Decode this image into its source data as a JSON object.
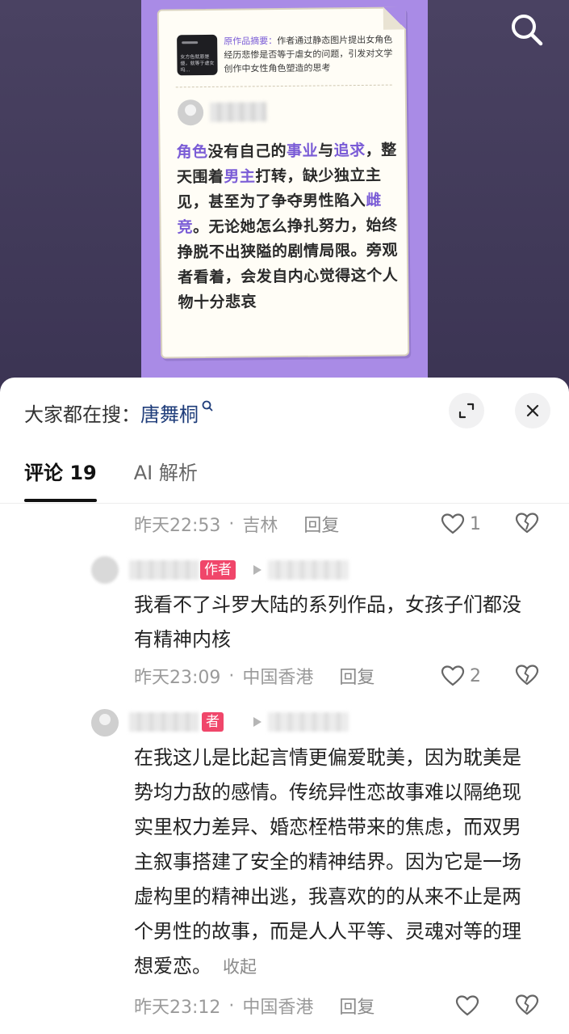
{
  "poster": {
    "summary_label": "原作品摘要：",
    "summary_text": "作者通过静态图片提出女角色经历悲惨是否等于虐女的问题，引发对文学创作中女性角色塑造的思考",
    "thumb_text": "女方色就原是傻，就等于虐女吗...",
    "quote_parts": [
      {
        "t": "角色",
        "hl": true
      },
      {
        "t": "没有自己的",
        "hl": false
      },
      {
        "t": "事业",
        "hl": true
      },
      {
        "t": "与",
        "hl": false
      },
      {
        "t": "追求",
        "hl": true
      },
      {
        "t": "，整天围着",
        "hl": false
      },
      {
        "t": "男主",
        "hl": true
      },
      {
        "t": "打转，缺少独立主见，甚至为了争夺男性陷入",
        "hl": false
      },
      {
        "t": "雌竞",
        "hl": true
      },
      {
        "t": "。无论她怎么挣扎努力，始终挣脱不出狭隘的剧情局限。旁观者看着，会发自内心觉得这个人物十分悲哀",
        "hl": false
      }
    ],
    "accent_color": "#7a5cd6",
    "background_color": "#a98be6"
  },
  "header": {
    "search_icon": "search-icon"
  },
  "sheet": {
    "search_prefix": "大家都在搜：",
    "search_term": "唐舞桐",
    "expand_icon": "expand-icon",
    "close_icon": "close-icon"
  },
  "tabs": [
    {
      "label": "评论 19",
      "active": true
    },
    {
      "label": "AI 解析",
      "active": false
    }
  ],
  "comments": [
    {
      "time": "昨天22:53",
      "location": "吉林",
      "reply_label": "回复",
      "likes": "1"
    },
    {
      "badge": "作者",
      "text": "我看不了斗罗大陆的系列作品，女孩子们都没有精神内核",
      "time": "昨天23:09",
      "location": "中国香港",
      "reply_label": "回复",
      "likes": "2"
    },
    {
      "badge": "者",
      "text": "在我这儿是比起言情更偏爱耽美，因为耽美是势均力敌的感情。传统异性恋故事难以隔绝现实里权力差异、婚恋桎梏带来的焦虑，而双男主叙事搭建了安全的精神结界。因为它是一场虚构里的精神出逃，我喜欢的的从来不止是两个男性的故事，而是人人平等、灵魂对等的理想爱恋。",
      "collapse_label": "收起",
      "time": "昨天23:12",
      "location": "中国香港",
      "reply_label": "回复",
      "likes": ""
    }
  ],
  "colors": {
    "author_badge": "#f0466a",
    "search_term": "#1f3d7a"
  }
}
